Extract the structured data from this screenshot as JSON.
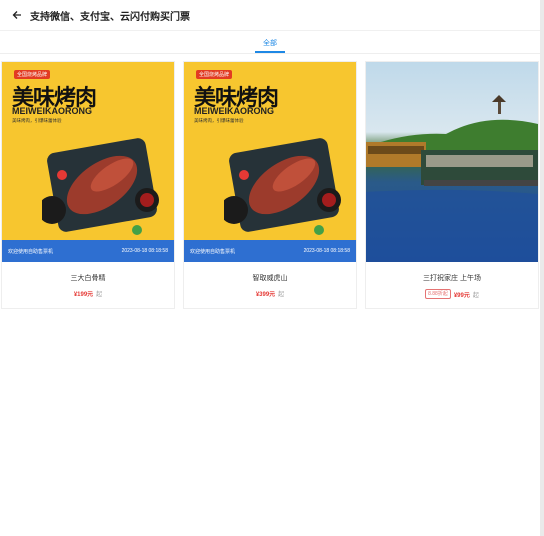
{
  "header": {
    "title": "支持微信、支付宝、云闪付购买门票"
  },
  "tabs": [
    {
      "label": "全部",
      "active": true
    }
  ],
  "products": [
    {
      "name": "三大白骨精",
      "price": "¥199元",
      "qi": "起",
      "promo": "",
      "image": "bbq-poster"
    },
    {
      "name": "智取威虎山",
      "price": "¥399元",
      "qi": "起",
      "promo": "",
      "image": "bbq-poster"
    },
    {
      "name": "三打祝家庄 上午场",
      "price": "¥99元",
      "qi": "起",
      "promo": "8.88折起",
      "image": "lake-boat-photo"
    }
  ],
  "poster": {
    "badge": "全国烧烤品牌",
    "headline": "美味烤肉",
    "english": "MEIWEIKAORONG",
    "subtitle": "美味烤肉，引爆味蕾体验",
    "footer_left": "欢迎使用自助售票机",
    "footer_right": "2023-08-18 08:18:58"
  },
  "colors": {
    "accent": "#1e88e5",
    "price": "#e53935",
    "poster_bg": "#f7c62f",
    "poster_bar": "#2e6fd1"
  }
}
